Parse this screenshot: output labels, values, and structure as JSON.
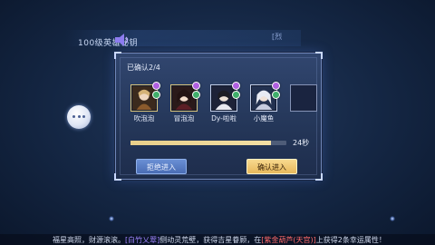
{
  "broadcast": {
    "text": "100级英雄秘钥",
    "tag": "[烈"
  },
  "dialog": {
    "confirm_status": "已确认2/4",
    "players": [
      {
        "name": "吹泡泡",
        "confirmed": true
      },
      {
        "name": "冒泡泡",
        "confirmed": true
      },
      {
        "name": "Dy-啦啦",
        "confirmed": false
      },
      {
        "name": "小魔鱼",
        "confirmed": false
      }
    ],
    "empty_slots": 1,
    "progress": 0.9,
    "countdown": "24秒",
    "reject_label": "拒绝进入",
    "accept_label": "确认进入"
  },
  "ticker": {
    "part1": "福星高照，财源滚滚。",
    "highlight1": "[白竹乂翠]",
    "part2": "侧动灵荒壁，获得吉星眷顾，在",
    "highlight2": "[紫金葫芦(天宫)]",
    "part3": "上获得2条幸运属性！"
  },
  "colors": {
    "dialog_bg": "#2b3e63",
    "progress_fill": "#efd699",
    "accept_button": "#f2c977",
    "reject_button": "#5b7fc6",
    "highlight_purple": "#9f86ff",
    "highlight_red": "#ff6a6a"
  },
  "icons": [
    "speaker-icon",
    "chat-icon",
    "role-badge-icon"
  ]
}
